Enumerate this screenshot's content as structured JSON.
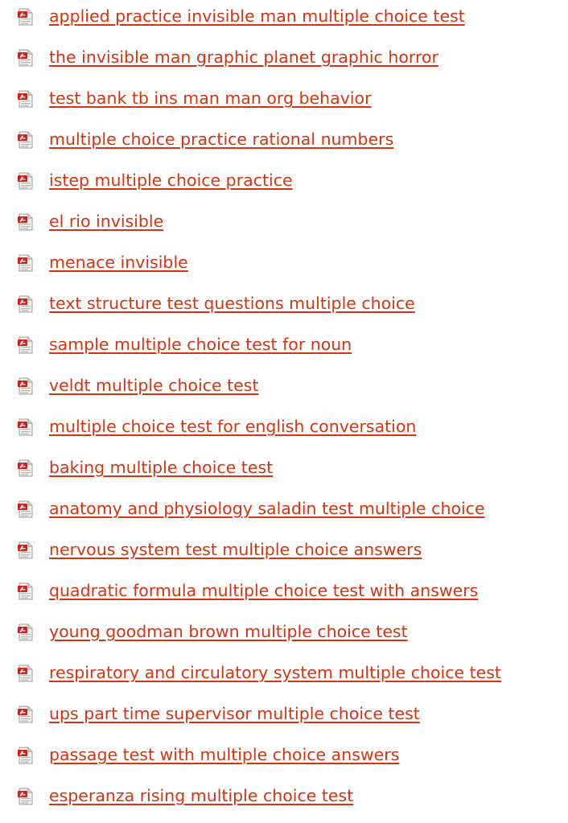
{
  "colors": {
    "link": "#d33512",
    "icon_red": "#cf1f1f",
    "icon_paper": "#f3f0ea"
  },
  "icon_name": "pdf-file-icon",
  "results": [
    {
      "title": "applied practice invisible man multiple choice test"
    },
    {
      "title": "the invisible man graphic planet graphic horror"
    },
    {
      "title": "test bank tb ins man man org behavior"
    },
    {
      "title": "multiple choice practice rational numbers"
    },
    {
      "title": "istep multiple choice practice"
    },
    {
      "title": "el rio invisible"
    },
    {
      "title": "menace invisible"
    },
    {
      "title": "text structure test questions multiple choice"
    },
    {
      "title": "sample multiple choice test for noun"
    },
    {
      "title": "veldt multiple choice test"
    },
    {
      "title": "multiple choice test for english conversation"
    },
    {
      "title": "baking multiple choice test"
    },
    {
      "title": "anatomy and physiology saladin test multiple choice"
    },
    {
      "title": "nervous system test multiple choice answers"
    },
    {
      "title": "quadratic formula multiple choice test with answers"
    },
    {
      "title": "young goodman brown multiple choice test"
    },
    {
      "title": "respiratory and circulatory system multiple choice test"
    },
    {
      "title": "ups part time supervisor multiple choice test"
    },
    {
      "title": "passage test with multiple choice answers"
    },
    {
      "title": "esperanza rising multiple choice test"
    }
  ]
}
